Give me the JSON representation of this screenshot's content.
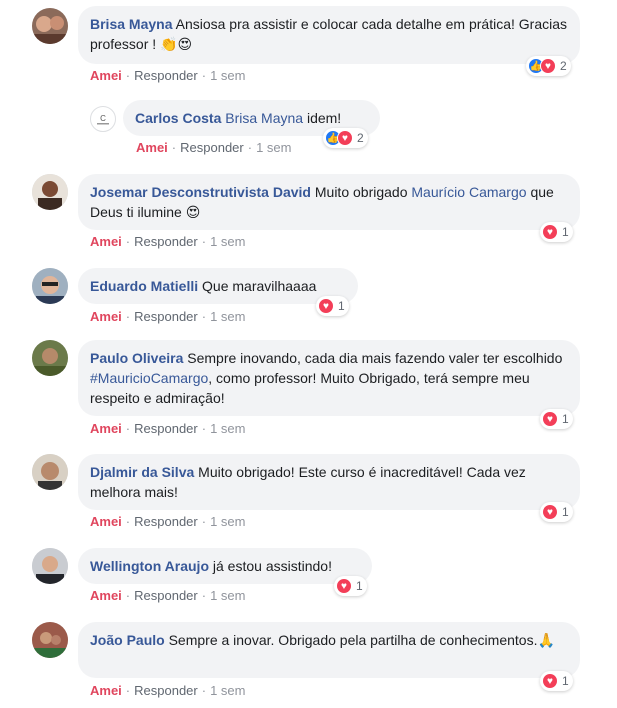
{
  "ui": {
    "like_label": "Amei",
    "reply_label": "Responder",
    "separator": "·"
  },
  "comments": [
    {
      "author": "Brisa Mayna",
      "text": "Ansiosa pra assistir e colocar cada detalhe em prática! Gracias professor ! 👏😍",
      "time": "1 sem",
      "reactions": {
        "types": [
          "like",
          "love"
        ],
        "count": "2"
      },
      "reply": {
        "author": "Carlos Costa",
        "mention": "Brisa Mayna",
        "text": "idem!",
        "time": "1 sem",
        "reactions": {
          "types": [
            "like",
            "love"
          ],
          "count": "2"
        }
      }
    },
    {
      "author": "Josemar Desconstrutivista David",
      "text_before": "Muito obrigado",
      "mention": "Maurício Camargo",
      "text_after": "que Deus ti ilumine 😍",
      "time": "1 sem",
      "reactions": {
        "types": [
          "love"
        ],
        "count": "1"
      }
    },
    {
      "author": "Eduardo Matielli",
      "text": "Que maravilhaaaa",
      "time": "1 sem",
      "reactions": {
        "types": [
          "love"
        ],
        "count": "1"
      }
    },
    {
      "author": "Paulo Oliveira",
      "text_before": "Sempre inovando, cada dia mais fazendo valer ter escolhido",
      "mention": "#MauricioCamargo",
      "text_after": ", como professor! Muito Obrigado, terá sempre meu respeito e admiração!",
      "time": "1 sem",
      "reactions": {
        "types": [
          "love"
        ],
        "count": "1"
      }
    },
    {
      "author": "Djalmir da Silva",
      "text": "Muito obrigado! Este curso é inacreditável! Cada vez melhora mais!",
      "time": "1 sem",
      "reactions": {
        "types": [
          "love"
        ],
        "count": "1"
      }
    },
    {
      "author": "Wellington Araujo",
      "text": "já estou assistindo!",
      "time": "1 sem",
      "reactions": {
        "types": [
          "love"
        ],
        "count": "1"
      }
    },
    {
      "author": "João Paulo",
      "text": "Sempre a inovar. Obrigado pela partilha de conhecimentos.🙏",
      "time": "1 sem",
      "reactions": {
        "types": [
          "love"
        ],
        "count": "1"
      }
    }
  ]
}
